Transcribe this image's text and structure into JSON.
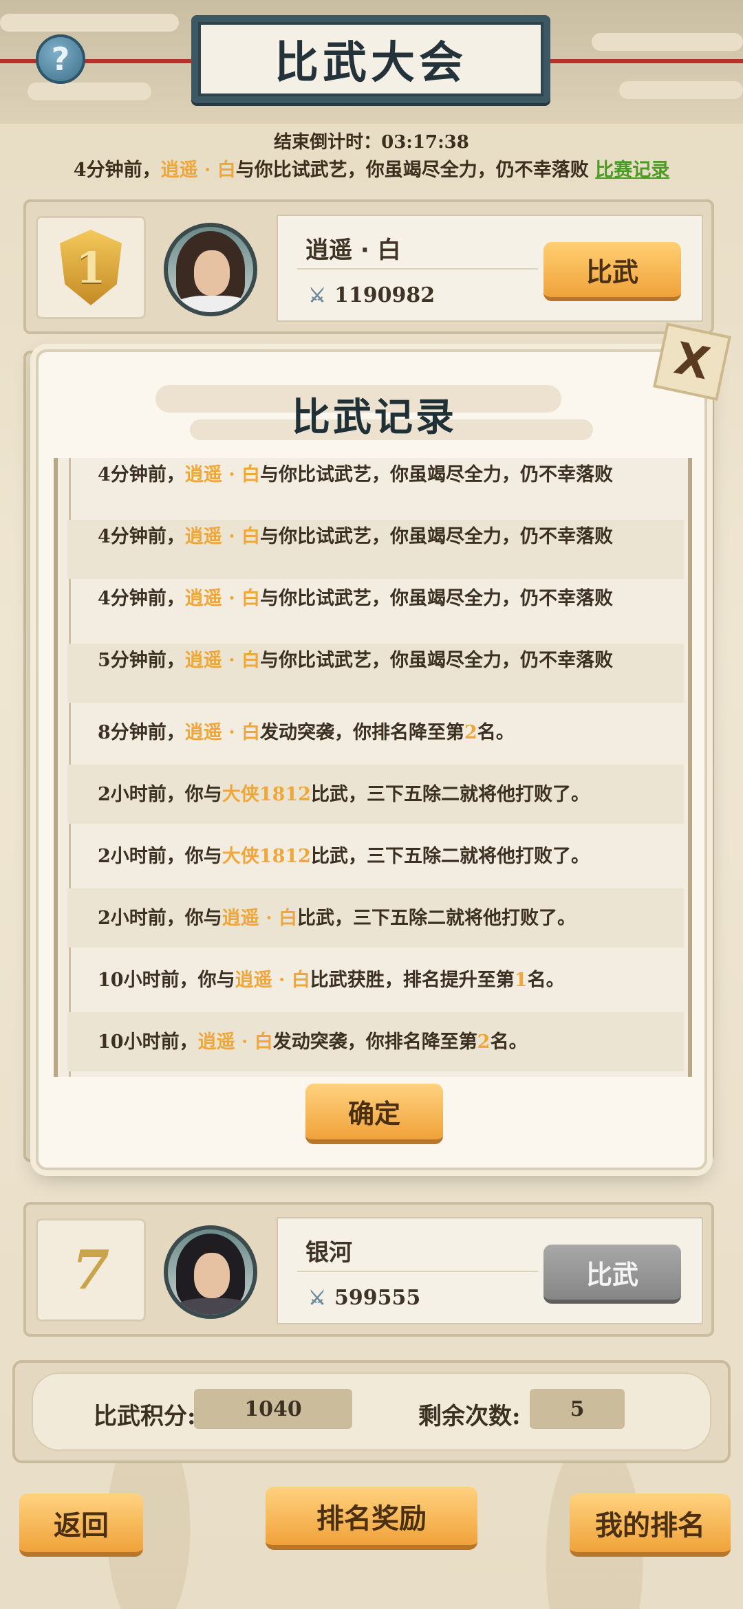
{
  "header": {
    "title": "比武大会",
    "help_icon": "?",
    "countdown_label": "结束倒计时：",
    "countdown_value": "03:17:38"
  },
  "notice": {
    "prefix": "4分钟前，",
    "name": "逍遥 · 白",
    "suffix": "与你比试武艺，你虽竭尽全力，仍不幸落败",
    "link": "比赛记录"
  },
  "ranks": [
    {
      "rank": "1",
      "name": "逍遥 · 白",
      "power": "1190982",
      "button": "比武"
    },
    {
      "rank": "7",
      "name": "银河",
      "power": "599555",
      "button": "比武"
    }
  ],
  "stats": {
    "score_label": "比武积分:",
    "score_value": "1040",
    "remaining_label": "剩余次数:",
    "remaining_value": "5"
  },
  "bottom_buttons": {
    "back": "返回",
    "rewards": "排名奖励",
    "my_rank": "我的排名"
  },
  "modal": {
    "title": "比武记录",
    "close": "X",
    "confirm": "确定",
    "records": [
      {
        "pre": "4分钟前，",
        "hl": "逍遥 · 白",
        "post": "与你比试武艺，你虽竭尽全力，仍不幸落败"
      },
      {
        "pre": "4分钟前，",
        "hl": "逍遥 · 白",
        "post": "与你比试武艺，你虽竭尽全力，仍不幸落败"
      },
      {
        "pre": "4分钟前，",
        "hl": "逍遥 · 白",
        "post": "与你比试武艺，你虽竭尽全力，仍不幸落败"
      },
      {
        "pre": "5分钟前，",
        "hl": "逍遥 · 白",
        "post": "与你比试武艺，你虽竭尽全力，仍不幸落败"
      },
      {
        "pre": "8分钟前，",
        "hl": "逍遥 · 白",
        "post": "发动突袭，你排名降至第",
        "num": "2",
        "tail": "名。"
      },
      {
        "pre": "2小时前，你与",
        "hl": "大侠1812",
        "post": "比武，三下五除二就将他打败了。"
      },
      {
        "pre": "2小时前，你与",
        "hl": "大侠1812",
        "post": "比武，三下五除二就将他打败了。"
      },
      {
        "pre": "2小时前，你与",
        "hl": "逍遥 · 白",
        "post": "比武，三下五除二就将他打败了。"
      },
      {
        "pre": "10小时前，你与",
        "hl": "逍遥 · 白",
        "post": "比武获胜，排名提升至第",
        "num": "1",
        "tail": "名。"
      },
      {
        "pre": "10小时前，",
        "hl": "逍遥 · 白",
        "post": "发动突袭，你排名降至第",
        "num": "2",
        "tail": "名。"
      }
    ]
  },
  "colors": {
    "highlight": "#f0a73a",
    "link": "#4d9a24",
    "button": "#f0a23a"
  }
}
